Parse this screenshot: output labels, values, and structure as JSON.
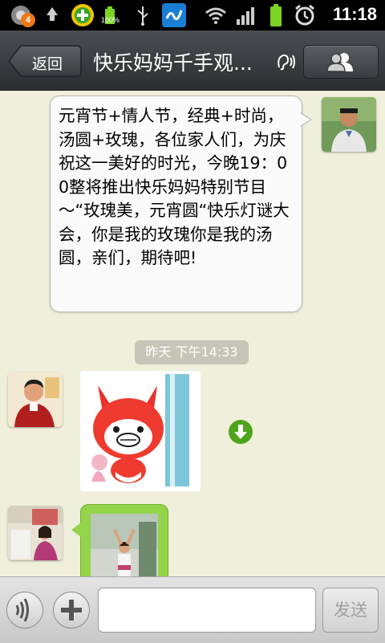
{
  "status_bar": {
    "notification_count": "4",
    "battery_percent": "100%",
    "time": "11:18",
    "icons": [
      "app-badge-icon",
      "recycle-icon",
      "game-plus-icon",
      "battery-icon",
      "usb-icon",
      "app-logo-icon",
      "wifi-icon",
      "signal-icon",
      "battery-icon",
      "alarm-icon"
    ]
  },
  "header": {
    "back_label": "返回",
    "title": "快乐妈妈千手观...",
    "earpiece_icon": "earpiece-icon",
    "members_icon": "members-icon"
  },
  "messages": [
    {
      "side": "right",
      "type": "text",
      "text": "元宵节+情人节，经典+时尚，汤圆+玫瑰，各位家人们，为庆祝这一美好的时光，今晚19：00整将推出快乐妈妈特别节目～“玫瑰美，元宵圆“快乐灯谜大会，你是我的玫瑰你是我的汤圆，亲们，期待吧!"
    },
    {
      "type": "timestamp",
      "text": "昨天 下午14:33"
    },
    {
      "side": "left",
      "type": "sticker",
      "download_icon": "download-icon"
    },
    {
      "side": "left",
      "type": "image"
    }
  ],
  "input_bar": {
    "voice_icon": "voice-icon",
    "plus_icon": "plus-icon",
    "placeholder": "",
    "send_label": "发送"
  },
  "colors": {
    "chat_background": "#efefdc",
    "title_bar": "#3a3c40",
    "image_bubble": "#94d44a",
    "download_green": "#4ea51c",
    "timestamp_pill": "#c6c6b8"
  }
}
